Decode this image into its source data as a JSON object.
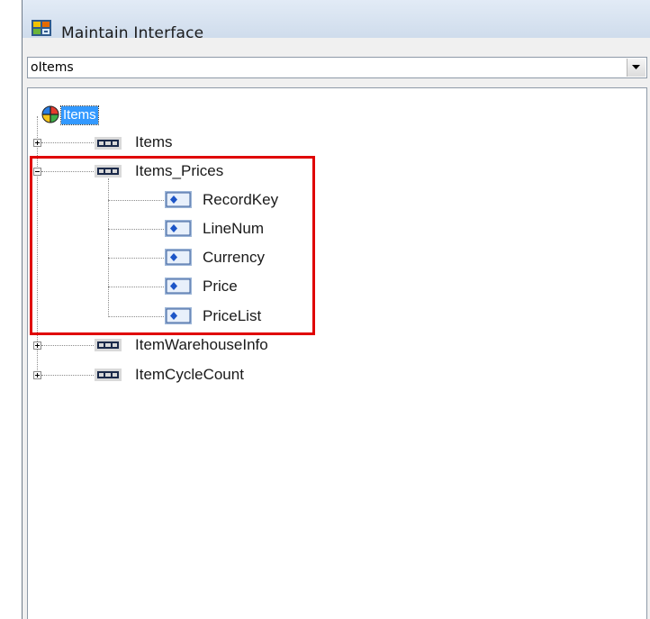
{
  "window": {
    "title": "Maintain Interface",
    "app_icon": "sap-interface-icon"
  },
  "combo": {
    "value": "oItems",
    "dropdown_icon": "chevron-down-icon"
  },
  "tree": {
    "root": {
      "label": "Items",
      "icon": "globe-icon",
      "selected": true
    },
    "nodes": [
      {
        "label": "Items",
        "icon": "table-icon",
        "expanded": false,
        "children": []
      },
      {
        "label": "Items_Prices",
        "icon": "table-icon",
        "expanded": true,
        "children": [
          {
            "label": "RecordKey",
            "icon": "field-icon"
          },
          {
            "label": "LineNum",
            "icon": "field-icon"
          },
          {
            "label": "Currency",
            "icon": "field-icon"
          },
          {
            "label": "Price",
            "icon": "field-icon"
          },
          {
            "label": "PriceList",
            "icon": "field-icon"
          }
        ]
      },
      {
        "label": "ItemWarehouseInfo",
        "icon": "table-icon",
        "expanded": false,
        "children": []
      },
      {
        "label": "ItemCycleCount",
        "icon": "table-icon",
        "expanded": false,
        "children": []
      }
    ]
  },
  "annotation": {
    "color": "#e00000"
  }
}
